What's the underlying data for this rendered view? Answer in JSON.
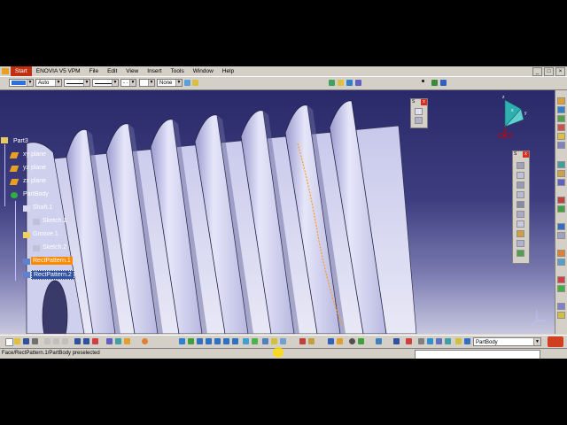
{
  "menu": {
    "items": [
      "Start",
      "ENOVIA V5 VPM",
      "File",
      "Edit",
      "View",
      "Insert",
      "Tools",
      "Window",
      "Help"
    ]
  },
  "window_controls": {
    "minimize": "_",
    "restore": "□",
    "close": "×"
  },
  "graphic_properties": {
    "fill_color": "#2f6fe0",
    "transparency": "Auto",
    "layer": "None",
    "dash": "- ·"
  },
  "tree": {
    "root": "Part3",
    "planes": [
      "xy plane",
      "yz plane",
      "zx plane"
    ],
    "body": "PartBody",
    "features": [
      {
        "label": "Shaft.1",
        "state": "normal"
      },
      {
        "label": "Sketch.1",
        "state": "normal"
      },
      {
        "label": "Groove.1",
        "state": "normal"
      },
      {
        "label": "Sketch.2",
        "state": "normal"
      },
      {
        "label": "RectPattern.1",
        "state": "selected"
      },
      {
        "label": "RectPattern.2",
        "state": "preselected"
      }
    ]
  },
  "floating_toolbars": {
    "small_title": "S",
    "tall_title": "S"
  },
  "compass": {
    "x": "x",
    "y": "y",
    "z": "z"
  },
  "bottom_toolbar": {
    "current_body": "PartBody"
  },
  "status": {
    "text": "Face/RectPattern.1/PartBody preselected"
  },
  "colors": {
    "viewport_top": "#2a2a6a",
    "viewport_bottom": "#c8c8e0",
    "selection": "#ff8a00",
    "preselection": "#3050a0",
    "part_face": "#d8d8f0"
  }
}
